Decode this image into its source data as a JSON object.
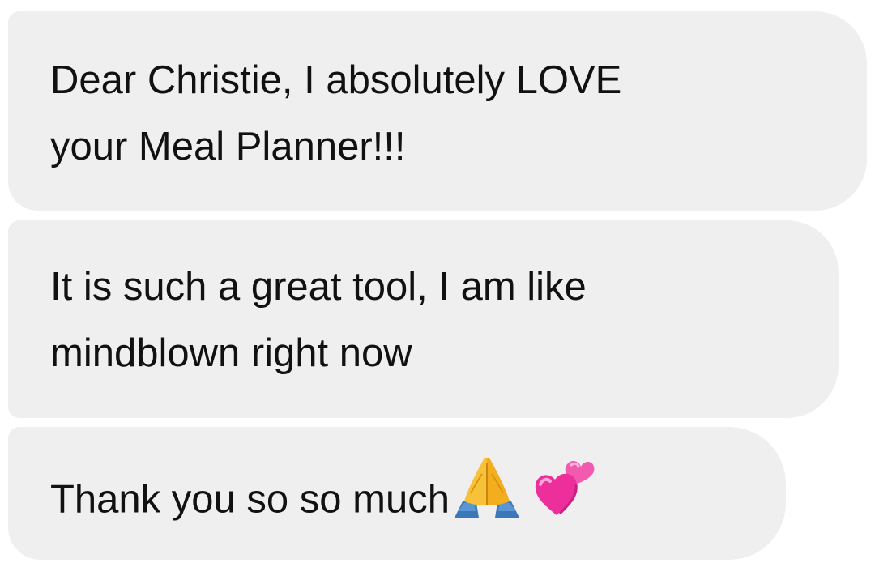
{
  "messages": [
    {
      "lines": [
        "Dear Christie, I absolutely LOVE",
        "your Meal Planner!!!"
      ]
    },
    {
      "lines": [
        "It is such a great tool, I am like",
        "mindblown right now"
      ]
    },
    {
      "text": "Thank you so so much",
      "icons": [
        "folded-hands-emoji",
        "two-hearts-emoji"
      ]
    }
  ],
  "colors": {
    "bubble_background": "#efefef",
    "text": "#111111",
    "page_background": "#ffffff"
  }
}
